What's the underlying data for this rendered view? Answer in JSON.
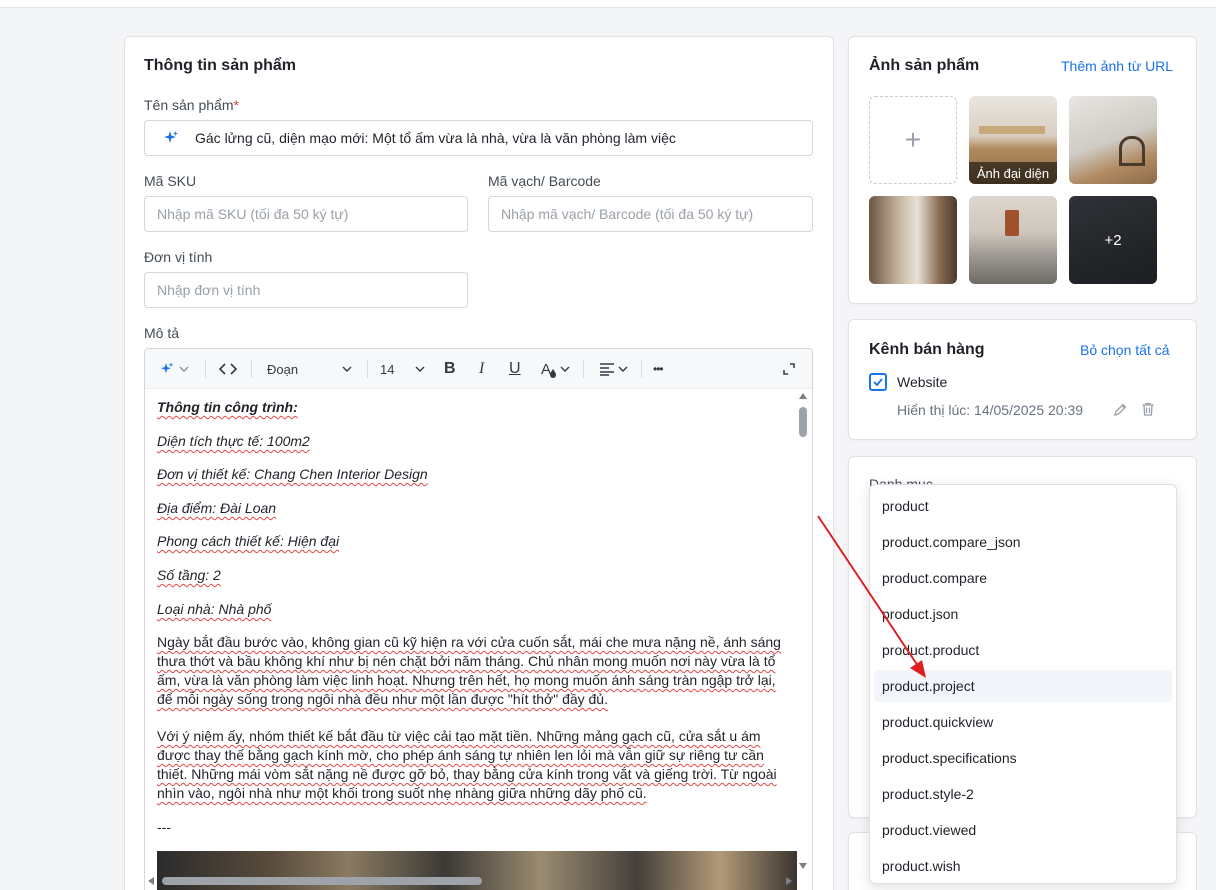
{
  "product_info": {
    "title": "Thông tin sản phẩm",
    "name_label": "Tên sản phẩm",
    "name_required": "*",
    "name_value": "Gác lửng cũ, diện mạo mới: Một tổ ấm vừa là nhà, vừa là văn phòng làm việc",
    "sku_label": "Mã SKU",
    "sku_placeholder": "Nhập mã SKU (tối đa 50 ký tự)",
    "barcode_label": "Mã vạch/ Barcode",
    "barcode_placeholder": "Nhập mã vạch/ Barcode (tối đa 50 ký tự)",
    "unit_label": "Đơn vị tính",
    "unit_placeholder": "Nhập đơn vị tính",
    "desc_label": "Mô tả"
  },
  "editor": {
    "paragraph_style": "Đoạn",
    "font_size": "14",
    "bold": "B",
    "italic": "I",
    "underline": "U",
    "color_letter": "A",
    "more": "•••",
    "lines": {
      "l1": "Thông tin công trình:",
      "l2": "Diện tích thực tế: 100m2",
      "l3": "Đơn vị thiết kế: Chang Chen Interior Design",
      "l4": "Địa điểm: Đài Loan",
      "l5": "Phong cách thiết kế: Hiện đại",
      "l6": "Số tầng: 2",
      "l7": "Loại nhà: Nhà phố",
      "p1": "Ngày bắt đầu bước vào, không gian cũ kỹ hiện ra với cửa cuốn sắt, mái che mưa nặng nề, ánh sáng thưa thớt và bầu không khí như bị nén chặt bởi năm tháng. Chủ nhân mong muốn nơi này vừa là tổ ấm, vừa là văn phòng làm việc linh hoạt. Nhưng trên hết, họ mong muốn ánh sáng tràn ngập trở lại, để mỗi ngày sống trong ngôi nhà đều như một lần được \"hít thở\" đầy đủ.",
      "p2": "Với ý niệm ấy, nhóm thiết kế bắt đầu từ việc cải tạo mặt tiền. Những mảng gạch cũ, cửa sắt u ám được thay thế bằng gạch kính mờ, cho phép ánh sáng tự nhiên len lỏi mà vẫn giữ sự riêng tư cần thiết. Những mái vòm sắt nặng nề được gỡ bỏ, thay bằng cửa kính trong vắt và giếng trời. Từ ngoài nhìn vào, ngôi nhà như một khối trong suốt nhẹ nhàng giữa những dãy phố cũ.",
      "sep": "---"
    }
  },
  "images": {
    "title": "Ảnh sản phẩm",
    "add_from_url": "Thêm ảnh từ URL",
    "add_symbol": "+",
    "featured_caption": "Ảnh đại diện",
    "more_count": "+2"
  },
  "channels": {
    "title": "Kênh bán hàng",
    "deselect_all": "Bỏ chọn tất cả",
    "website_label": "Website",
    "display_time": "Hiển thị lúc: 14/05/2025 20:39"
  },
  "category": {
    "label_partial": "Danh mục",
    "options": [
      "product",
      "product.compare_json",
      "product.compare",
      "product.json",
      "product.product",
      "product.project",
      "product.quickview",
      "product.specifications",
      "product.style-2",
      "product.viewed",
      "product.wish"
    ],
    "highlighted": "product.project"
  },
  "colors": {
    "accent": "#1a73e8",
    "annotation_arrow": "#e02020"
  }
}
